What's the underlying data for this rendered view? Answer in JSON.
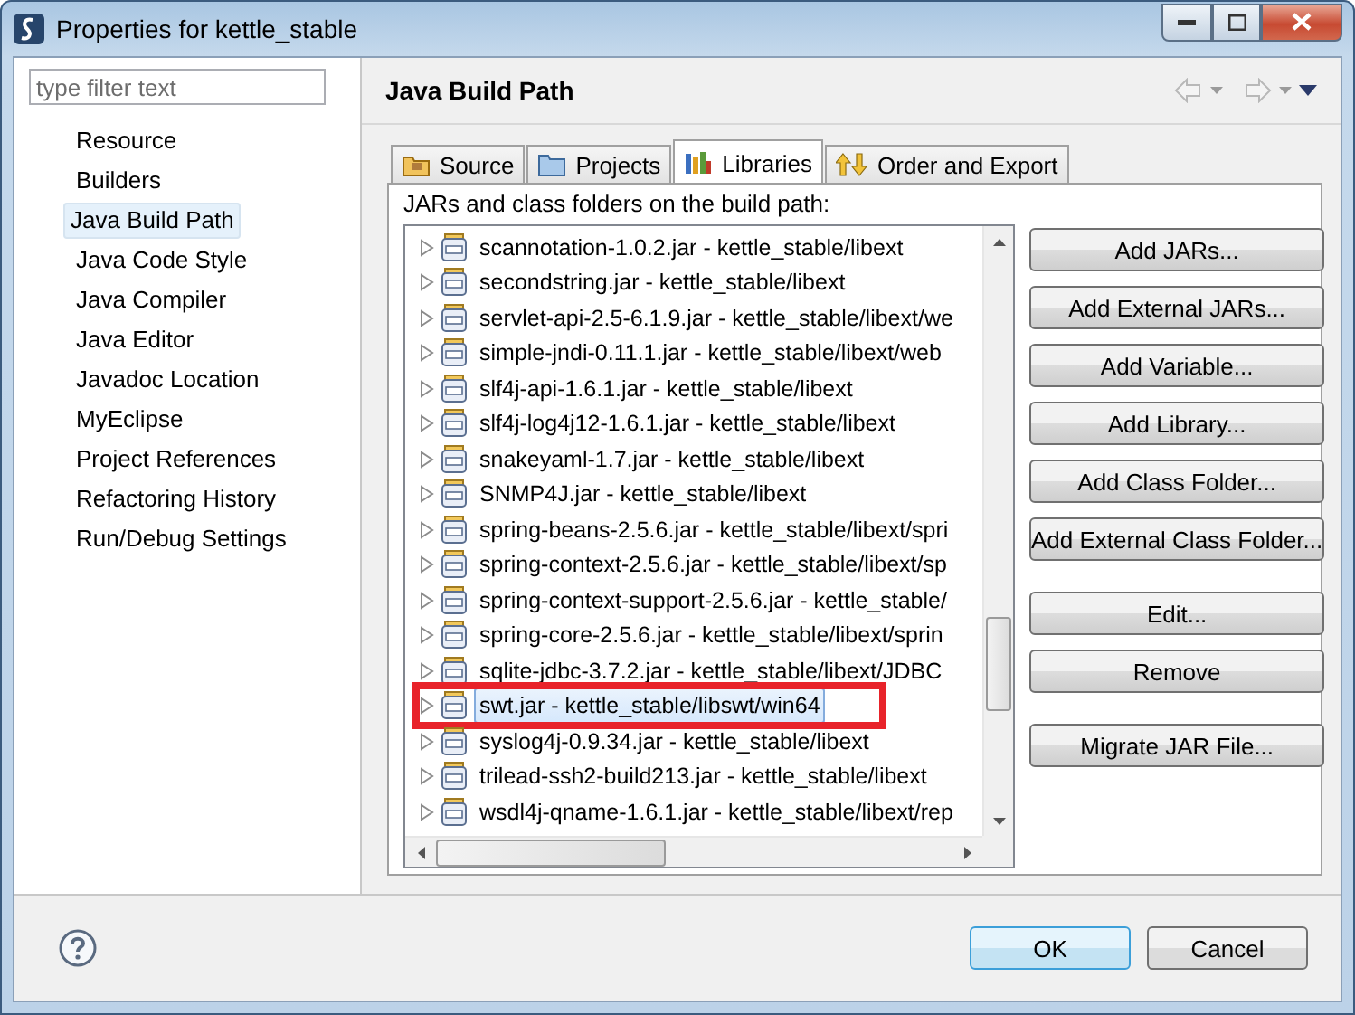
{
  "window": {
    "title": "Properties for kettle_stable"
  },
  "filter": {
    "placeholder": "type filter text"
  },
  "sidebar": {
    "items": [
      {
        "label": "Resource",
        "selected": false
      },
      {
        "label": "Builders",
        "selected": false
      },
      {
        "label": "Java Build Path",
        "selected": true
      },
      {
        "label": "Java Code Style",
        "selected": false
      },
      {
        "label": "Java Compiler",
        "selected": false
      },
      {
        "label": "Java Editor",
        "selected": false
      },
      {
        "label": "Javadoc Location",
        "selected": false
      },
      {
        "label": "MyEclipse",
        "selected": false
      },
      {
        "label": "Project References",
        "selected": false
      },
      {
        "label": "Refactoring History",
        "selected": false
      },
      {
        "label": "Run/Debug Settings",
        "selected": false
      }
    ]
  },
  "page": {
    "title": "Java Build Path"
  },
  "tabs": [
    {
      "label": "Source",
      "kind": "source",
      "selected": false
    },
    {
      "label": "Projects",
      "kind": "projects",
      "selected": false
    },
    {
      "label": "Libraries",
      "kind": "libraries",
      "selected": true
    },
    {
      "label": "Order and Export",
      "kind": "order",
      "selected": false
    }
  ],
  "list": {
    "caption": "JARs and class folders on the build path:",
    "rows": [
      {
        "label": "scannotation-1.0.2.jar - kettle_stable/libext",
        "expanded": false,
        "selected": false,
        "annotated": false
      },
      {
        "label": "secondstring.jar - kettle_stable/libext",
        "expanded": false,
        "selected": false,
        "annotated": false
      },
      {
        "label": "servlet-api-2.5-6.1.9.jar - kettle_stable/libext/we",
        "expanded": false,
        "selected": false,
        "annotated": false
      },
      {
        "label": "simple-jndi-0.11.1.jar - kettle_stable/libext/web",
        "expanded": false,
        "selected": false,
        "annotated": false
      },
      {
        "label": "slf4j-api-1.6.1.jar - kettle_stable/libext",
        "expanded": false,
        "selected": false,
        "annotated": false
      },
      {
        "label": "slf4j-log4j12-1.6.1.jar - kettle_stable/libext",
        "expanded": false,
        "selected": false,
        "annotated": false
      },
      {
        "label": "snakeyaml-1.7.jar - kettle_stable/libext",
        "expanded": false,
        "selected": false,
        "annotated": false
      },
      {
        "label": "SNMP4J.jar - kettle_stable/libext",
        "expanded": false,
        "selected": false,
        "annotated": false
      },
      {
        "label": "spring-beans-2.5.6.jar - kettle_stable/libext/spri",
        "expanded": false,
        "selected": false,
        "annotated": false
      },
      {
        "label": "spring-context-2.5.6.jar - kettle_stable/libext/sp",
        "expanded": false,
        "selected": false,
        "annotated": false
      },
      {
        "label": "spring-context-support-2.5.6.jar - kettle_stable/",
        "expanded": false,
        "selected": false,
        "annotated": false
      },
      {
        "label": "spring-core-2.5.6.jar - kettle_stable/libext/sprin",
        "expanded": false,
        "selected": false,
        "annotated": false
      },
      {
        "label": "sqlite-jdbc-3.7.2.jar - kettle_stable/libext/JDBC",
        "expanded": false,
        "selected": false,
        "annotated": false
      },
      {
        "label": "swt.jar - kettle_stable/libswt/win64",
        "expanded": false,
        "selected": true,
        "annotated": true
      },
      {
        "label": "syslog4j-0.9.34.jar - kettle_stable/libext",
        "expanded": false,
        "selected": false,
        "annotated": false
      },
      {
        "label": "trilead-ssh2-build213.jar - kettle_stable/libext",
        "expanded": false,
        "selected": false,
        "annotated": false
      },
      {
        "label": "wsdl4j-qname-1.6.1.jar - kettle_stable/libext/rep",
        "expanded": false,
        "selected": false,
        "annotated": false
      }
    ]
  },
  "side_button_groups": [
    [
      "Add JARs...",
      "Add External JARs...",
      "Add Variable...",
      "Add Library...",
      "Add Class Folder...",
      "Add External Class Folder..."
    ],
    [
      "Edit...",
      "Remove"
    ],
    [
      "Migrate JAR File..."
    ]
  ],
  "footer": {
    "buttons": [
      {
        "label": "OK",
        "kind": "default"
      },
      {
        "label": "Cancel",
        "kind": "normal"
      }
    ]
  }
}
